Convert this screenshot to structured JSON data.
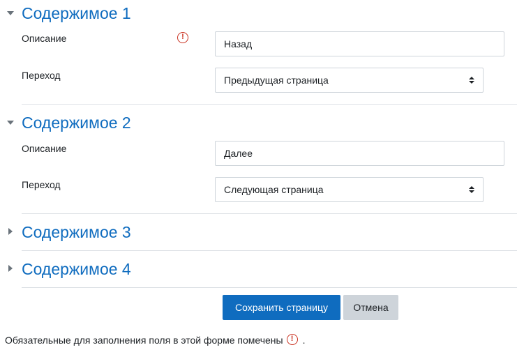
{
  "sections": [
    {
      "title": "Содержимое 1",
      "expanded": true,
      "description_label": "Описание",
      "description_value": "Назад",
      "description_required": true,
      "transition_label": "Переход",
      "transition_value": "Предыдущая страница"
    },
    {
      "title": "Содержимое 2",
      "expanded": true,
      "description_label": "Описание",
      "description_value": "Далее",
      "transition_label": "Переход",
      "transition_value": "Следующая страница"
    },
    {
      "title": "Содержимое 3",
      "expanded": false
    },
    {
      "title": "Содержимое 4",
      "expanded": false
    }
  ],
  "buttons": {
    "save_label": "Сохранить страницу",
    "cancel_label": "Отмена"
  },
  "footer": {
    "required_note": "Обязательные для заполнения поля в этой форме помечены",
    "required_note_suffix": "."
  },
  "icons": {
    "required": "exclamation-circle-icon",
    "expanded": "caret-down-icon",
    "collapsed": "caret-right-icon",
    "select": "sort-arrows-icon"
  },
  "colors": {
    "accent": "#0f6cbf",
    "required": "#ca3120",
    "secondary_button": "#ced4da",
    "divider": "#dee2e6"
  }
}
